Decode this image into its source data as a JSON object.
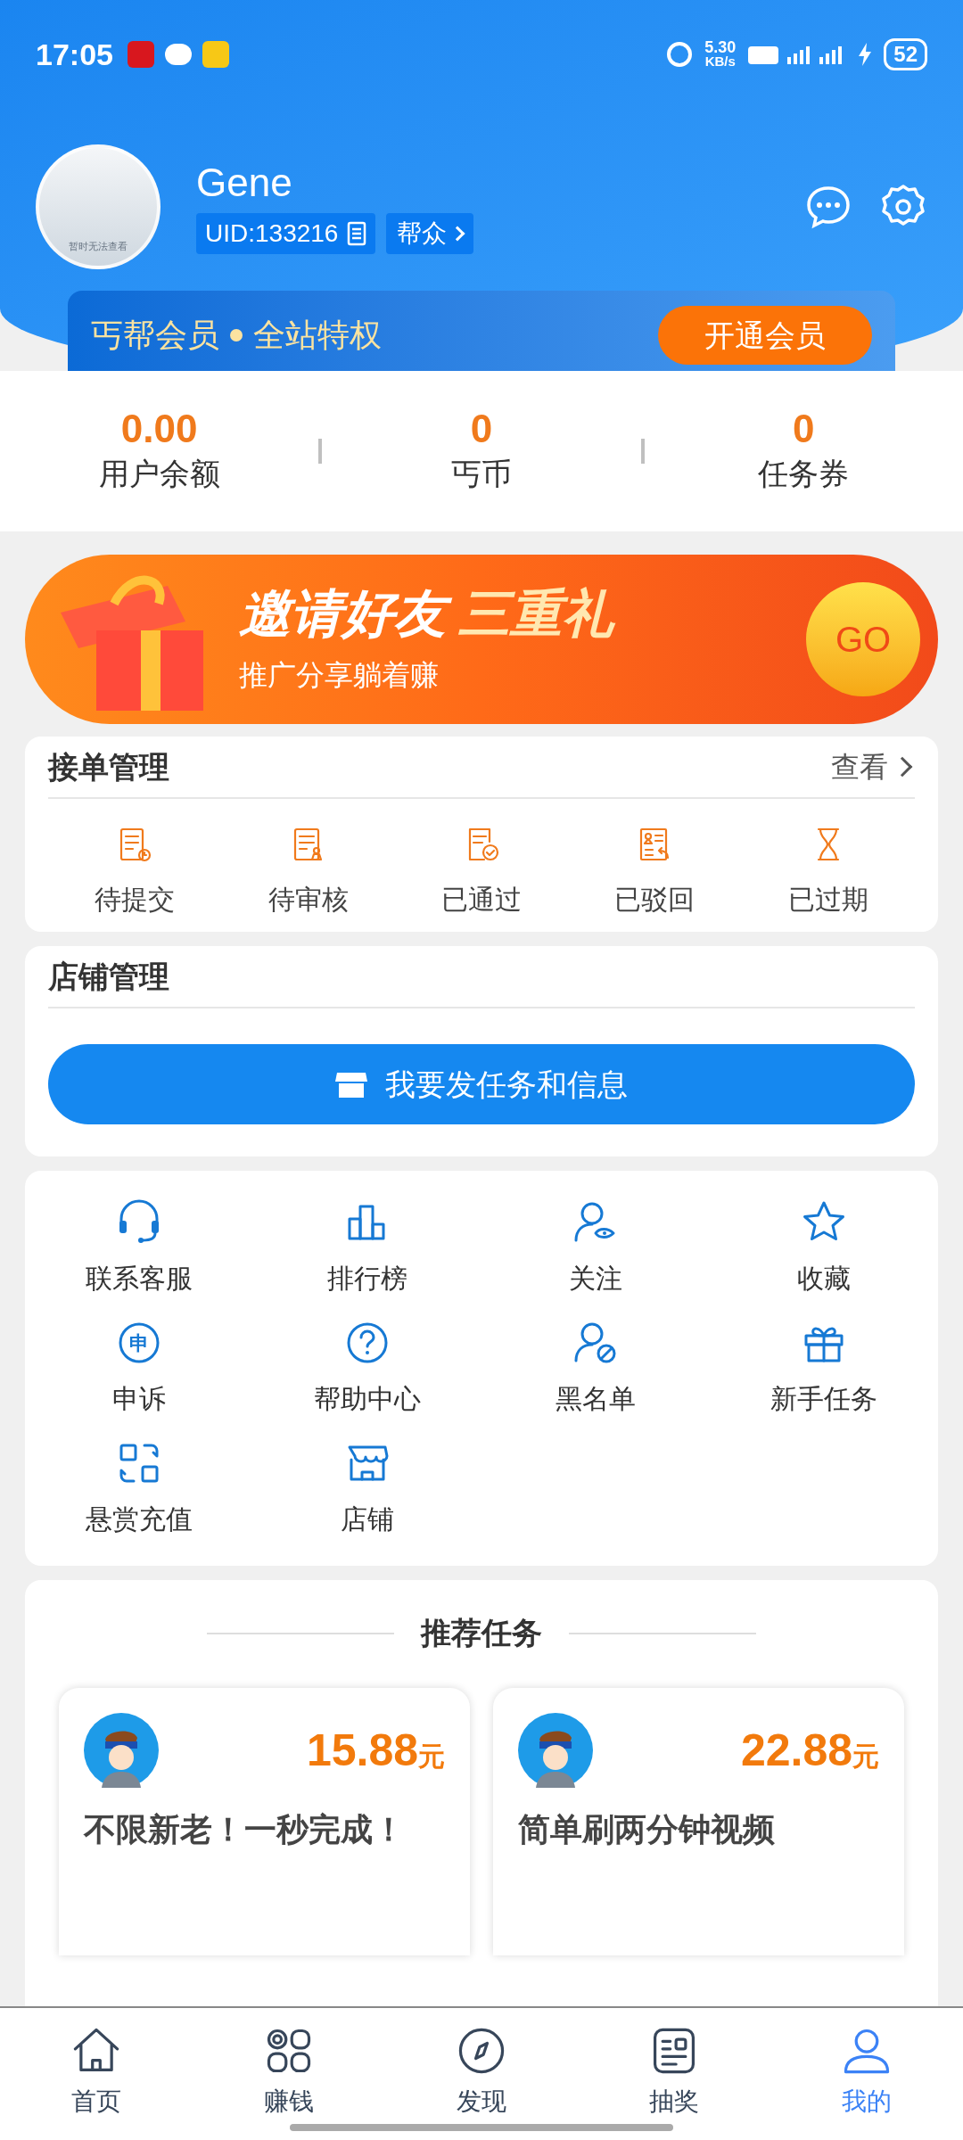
{
  "status_bar": {
    "time": "17:05",
    "speed": "5.30",
    "speed_unit": "KB/s",
    "battery": "52"
  },
  "profile": {
    "avatar_caption": "暂时无法查看",
    "name": "Gene",
    "uid": "UID:133216",
    "group": "帮众"
  },
  "membership": {
    "title": "丐帮会员",
    "subtitle": "全站特权",
    "button": "开通会员"
  },
  "stats": [
    {
      "value": "0.00",
      "label": "用户余额"
    },
    {
      "value": "0",
      "label": "丐币"
    },
    {
      "value": "0",
      "label": "任务券"
    }
  ],
  "banner": {
    "title": "邀请好友",
    "highlight": "三重礼",
    "subtitle": "推广分享躺着赚",
    "button": "GO"
  },
  "orders": {
    "title": "接单管理",
    "link": "查看",
    "items": [
      {
        "kind": "pending",
        "label": "待提交"
      },
      {
        "kind": "review",
        "label": "待审核"
      },
      {
        "kind": "passed",
        "label": "已通过"
      },
      {
        "kind": "rejected",
        "label": "已驳回"
      },
      {
        "kind": "expired",
        "label": "已过期"
      }
    ]
  },
  "store": {
    "title": "店铺管理",
    "button": "我要发任务和信息"
  },
  "tools": [
    {
      "kind": "service",
      "label": "联系客服"
    },
    {
      "kind": "ranking",
      "label": "排行榜"
    },
    {
      "kind": "follow",
      "label": "关注"
    },
    {
      "kind": "favorite",
      "label": "收藏"
    },
    {
      "kind": "appeal",
      "label": "申诉",
      "glyph": "申"
    },
    {
      "kind": "help",
      "label": "帮助中心"
    },
    {
      "kind": "blacklist",
      "label": "黑名单"
    },
    {
      "kind": "gift",
      "label": "新手任务"
    },
    {
      "kind": "recharge",
      "label": "悬赏充值"
    },
    {
      "kind": "shop",
      "label": "店铺"
    }
  ],
  "recommended": {
    "title": "推荐任务",
    "tasks": [
      {
        "price": "15.88",
        "unit": "元",
        "title": "不限新老！一秒完成！"
      },
      {
        "price": "22.88",
        "unit": "元",
        "title": "简单刷两分钟视频"
      }
    ]
  },
  "tab_bar": [
    {
      "kind": "home",
      "label": "首页",
      "selected": false
    },
    {
      "kind": "earn",
      "label": "赚钱",
      "selected": false
    },
    {
      "kind": "discover",
      "label": "发现",
      "selected": false
    },
    {
      "kind": "lottery",
      "label": "抽奖",
      "selected": false
    },
    {
      "kind": "me",
      "label": "我的",
      "selected": true
    }
  ]
}
